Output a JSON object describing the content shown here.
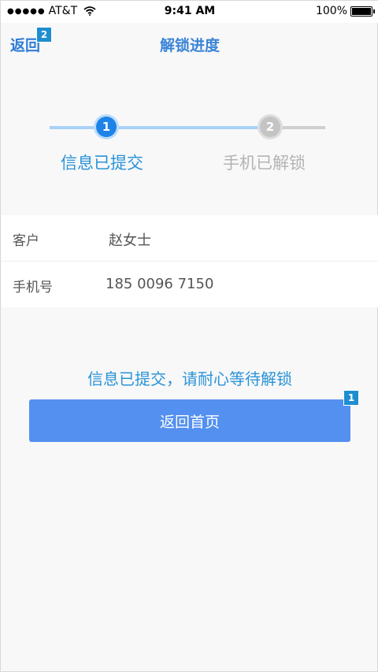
{
  "status_bar": {
    "signal": "●●●●●",
    "carrier": "AT&T",
    "time": "9:41 AM",
    "battery": "100%"
  },
  "nav": {
    "back_label": "返回",
    "back_badge": "2",
    "title": "解锁进度"
  },
  "steps": [
    {
      "number": "1",
      "label": "信息已提交",
      "state": "active"
    },
    {
      "number": "2",
      "label": "手机已解锁",
      "state": "inactive"
    }
  ],
  "info": {
    "customer_label": "客户",
    "customer_value": "赵女士",
    "phone_label": "手机号",
    "phone_value": "185 0096 7150"
  },
  "message": "信息已提交，请耐心等待解锁",
  "home_button": {
    "label": "返回首页",
    "badge": "1"
  },
  "colors": {
    "accent": "#2a93d6",
    "button": "#5390f0",
    "step_active": "#1e83e8",
    "step_inactive": "#c4c4c4"
  },
  "icons": [
    "wifi-icon",
    "battery-icon",
    "signal-icon"
  ]
}
